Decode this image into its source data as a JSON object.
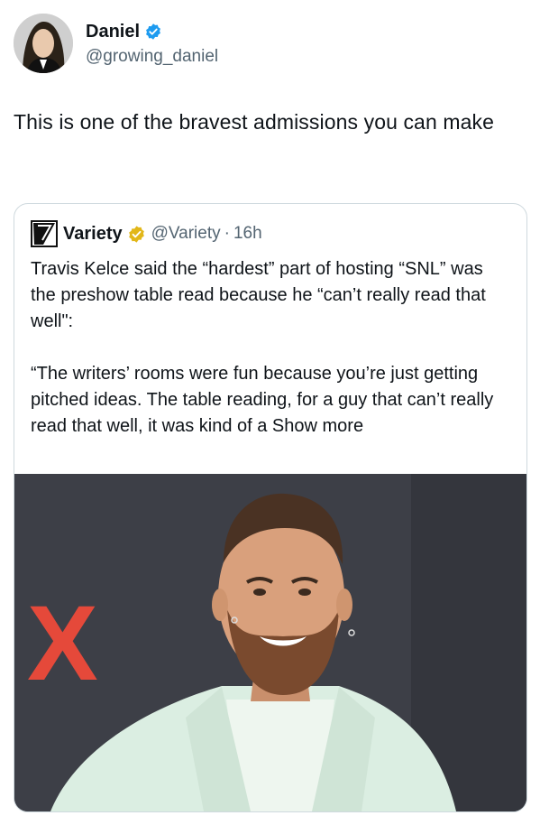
{
  "author": {
    "display_name": "Daniel",
    "handle": "@growing_daniel",
    "verified_icon": "verified-badge-icon",
    "verified_color": "#1d9bf0"
  },
  "tweet": {
    "text": "This is one of the bravest admissions you can make"
  },
  "quoted": {
    "display_name": "Variety",
    "handle": "@Variety",
    "separator": "·",
    "time": "16h",
    "badge_icon": "gold-verified-badge-icon",
    "badge_color": "#e2b719",
    "body_para1": "Travis Kelce said the “hardest” part of hosting “SNL” was the preshow table read because he “can’t really read that well\":",
    "body_para2": "“The writers’ rooms were fun because you’re just getting pitched ideas. The table reading, for a guy that can’t really read that well, it was kind of a",
    "show_more": "Show more",
    "media": {
      "backdrop_letter": "X",
      "backdrop_color": "#3d3f47",
      "letter_color": "#e5493a"
    }
  }
}
